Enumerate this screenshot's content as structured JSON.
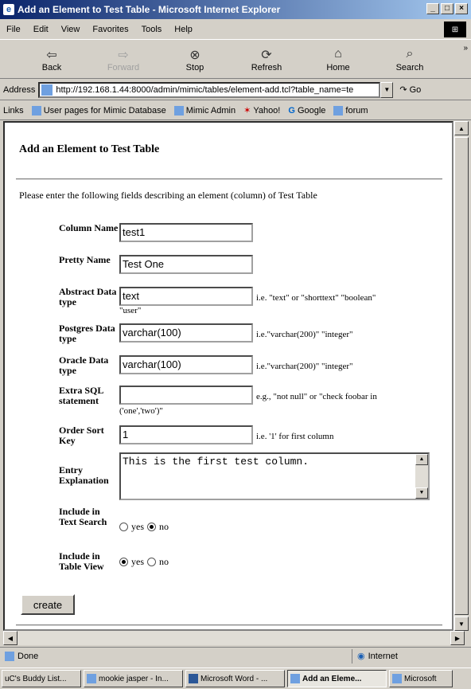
{
  "window": {
    "title": "Add an Element to Test Table - Microsoft Internet Explorer",
    "minimize": "_",
    "maximize": "□",
    "close": "×",
    "ie_logo": "e"
  },
  "menu": {
    "items": [
      "File",
      "Edit",
      "View",
      "Favorites",
      "Tools",
      "Help"
    ]
  },
  "toolbar": {
    "back": "Back",
    "forward": "Forward",
    "stop": "Stop",
    "refresh": "Refresh",
    "home": "Home",
    "search": "Search"
  },
  "address": {
    "label": "Address",
    "url": "http://192.168.1.44:8000/admin/mimic/tables/element-add.tcl?table_name=te",
    "go": "Go"
  },
  "links": {
    "label": "Links",
    "items": [
      "User pages for Mimic Database",
      "Mimic Admin",
      "Yahoo!",
      "Google",
      "forum"
    ]
  },
  "page": {
    "heading": "Add an Element to Test Table",
    "intro": "Please enter the following fields describing an element (column) of Test Table",
    "fields": {
      "column_name": {
        "label": "Column Name",
        "value": "test1"
      },
      "pretty_name": {
        "label": "Pretty Name",
        "value": "Test One"
      },
      "abstract_type": {
        "label": "Abstract Data type",
        "value": "text",
        "hint": "i.e. \"text\" or \"shorttext\" \"boolean\"",
        "hint2": "\"user\""
      },
      "postgres_type": {
        "label": "Postgres Data type",
        "value": "varchar(100)",
        "hint": "i.e.\"varchar(200)\" \"integer\""
      },
      "oracle_type": {
        "label": "Oracle Data type",
        "value": "varchar(100)",
        "hint": "i.e.\"varchar(200)\" \"integer\""
      },
      "extra_sql": {
        "label": "Extra SQL statement",
        "value": "",
        "hint": "e.g., \"not null\" or \"check foobar in",
        "hint2": "('one','two')\""
      },
      "order_sort": {
        "label": "Order Sort Key",
        "value": "1",
        "hint": "i.e. '1' for first column"
      },
      "explanation": {
        "label": "Entry Explanation",
        "value": "This is the first test column."
      },
      "text_search": {
        "label": "Include in Text Search",
        "yes": "yes",
        "no": "no",
        "selected": "no"
      },
      "table_view": {
        "label": "Include in Table View",
        "yes": "yes",
        "no": "no",
        "selected": "yes"
      }
    },
    "create": "create"
  },
  "status": {
    "text": "Done",
    "zone": "Internet"
  },
  "taskbar": {
    "items": [
      "uC's Buddy List...",
      "mookie jasper - In...",
      "Microsoft Word - ...",
      "Add an Eleme...",
      "Microsoft"
    ]
  },
  "colors": {
    "title_start": "#0a246a",
    "title_end": "#a6caf0",
    "chrome": "#d4d0c8"
  }
}
